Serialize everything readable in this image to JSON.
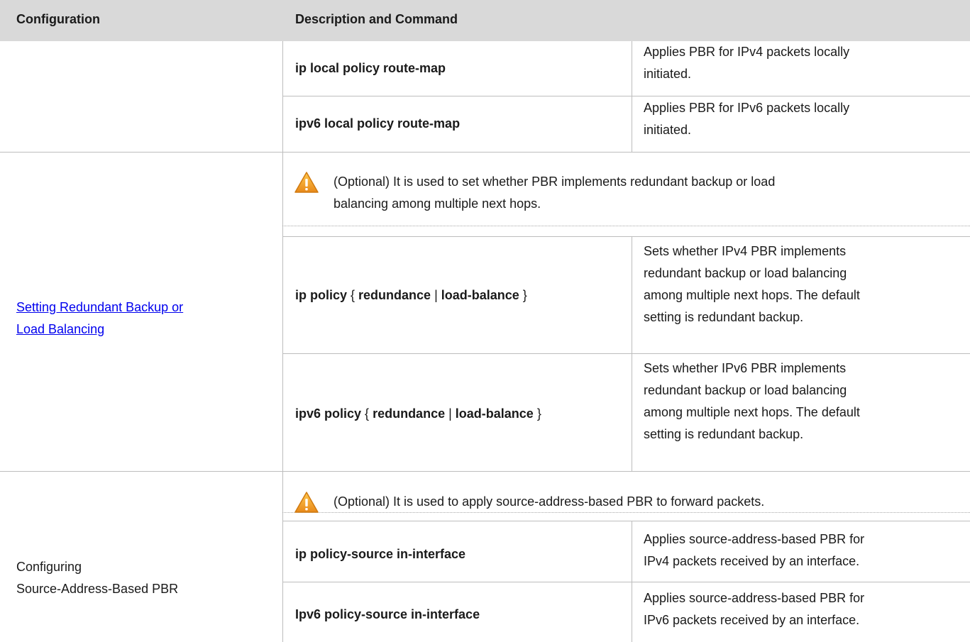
{
  "header": {
    "col_config": "Configuration",
    "col_desc": "Description and Command"
  },
  "rows": [
    {
      "config_lines": [],
      "commands": [
        {
          "name": "ip local policy route-map",
          "desc_lines": [
            "Applies PBR for IPv4 packets locally",
            "initiated."
          ]
        },
        {
          "name": "ipv6 local policy route-map",
          "desc_lines": [
            "Applies PBR for IPv6 packets locally",
            "initiated."
          ]
        }
      ]
    },
    {
      "config_lines": [
        "Setting Redundant Backup or ",
        "Load Balancing"
      ],
      "config_is_link": true,
      "note_icon": "warning-icon",
      "note_lines": [
        "(Optional) It is used to set whether PBR implements redundant backup or load",
        "balancing among multiple next hops."
      ],
      "commands": [
        {
          "cmd_a": "ip policy",
          "brace_open": " { ",
          "opt1": "redundance",
          "bar": " | ",
          "opt2": "load-balance",
          "brace_close": " }",
          "desc_lines": [
            "Sets whether IPv4 PBR implements",
            "redundant backup or load balancing",
            "among multiple next hops. The default",
            "setting is redundant backup."
          ]
        },
        {
          "cmd_a": "ipv6 policy",
          "brace_open": " { ",
          "opt1": "redundance",
          "bar": " | ",
          "opt2": "load-balance",
          "brace_close": " }",
          "desc_lines": [
            "Sets whether IPv6 PBR implements",
            "redundant backup or load balancing",
            "among multiple next hops. The default",
            "setting is redundant backup."
          ]
        }
      ]
    },
    {
      "config_lines": [
        "Configuring",
        "Source-Address-Based PBR"
      ],
      "config_is_link": false,
      "note_icon": "warning-icon",
      "note_lines": [
        "(Optional) It is used to apply source-address-based PBR to forward packets."
      ],
      "commands": [
        {
          "name": "ip policy-source in-interface",
          "desc_lines": [
            "Applies source-address-based PBR for",
            "IPv4 packets received by an interface."
          ]
        },
        {
          "name": "Ipv6 policy-source in-interface",
          "desc_lines": [
            "Applies source-address-based PBR for",
            "IPv6 packets received by an interface."
          ]
        }
      ]
    }
  ],
  "colors": {
    "header_bg": "#d9d9d9",
    "link": "#0000ee",
    "warning_fill": "#f5a623",
    "grid_line": "#bdbdbd"
  }
}
